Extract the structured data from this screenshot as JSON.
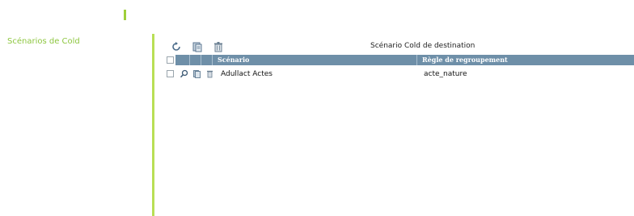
{
  "sidebar": {
    "title": "Scénarios de Cold"
  },
  "panel": {
    "title": "Scénario Cold de destination"
  },
  "toolbar": {
    "icons": [
      "refresh-icon",
      "copy-icon",
      "trash-icon"
    ]
  },
  "table": {
    "columns": [
      "Scénario",
      "Règle de regroupement"
    ],
    "rows": [
      {
        "scenario": "Adullact Actes",
        "rule": "acte_nature"
      }
    ]
  },
  "colors": {
    "accent": "#8dc63f",
    "divider": "#b9df55",
    "header_bg": "#6e8fa8"
  }
}
